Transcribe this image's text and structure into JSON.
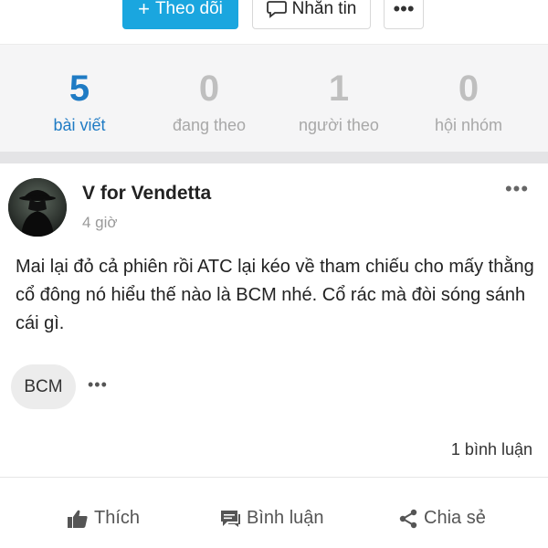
{
  "profile_actions": {
    "follow_label": "Theo dõi",
    "message_label": "Nhắn tin",
    "more_label": "•••"
  },
  "stats": [
    {
      "value": "5",
      "label": "bài viết"
    },
    {
      "value": "0",
      "label": "đang theo"
    },
    {
      "value": "1",
      "label": "người theo"
    },
    {
      "value": "0",
      "label": "hội nhóm"
    }
  ],
  "post": {
    "author": "V for Vendetta",
    "time": "4 giờ",
    "more_label": "•••",
    "content": "Mai lại đỏ cả phiên rồi ATC lại kéo về tham chiếu cho mấy thằng cổ đông nó hiểu thế nào là BCM nhé. Cổ rác mà đòi sóng sánh cái gì.",
    "tag": "BCM",
    "tag_more": "•••",
    "comments": "1 bình luận"
  },
  "reactions": {
    "like": "Thích",
    "comment": "Bình luận",
    "share": "Chia sẻ"
  },
  "colors": {
    "accent": "#1aa6df",
    "active_stat": "#1f7bc4"
  }
}
